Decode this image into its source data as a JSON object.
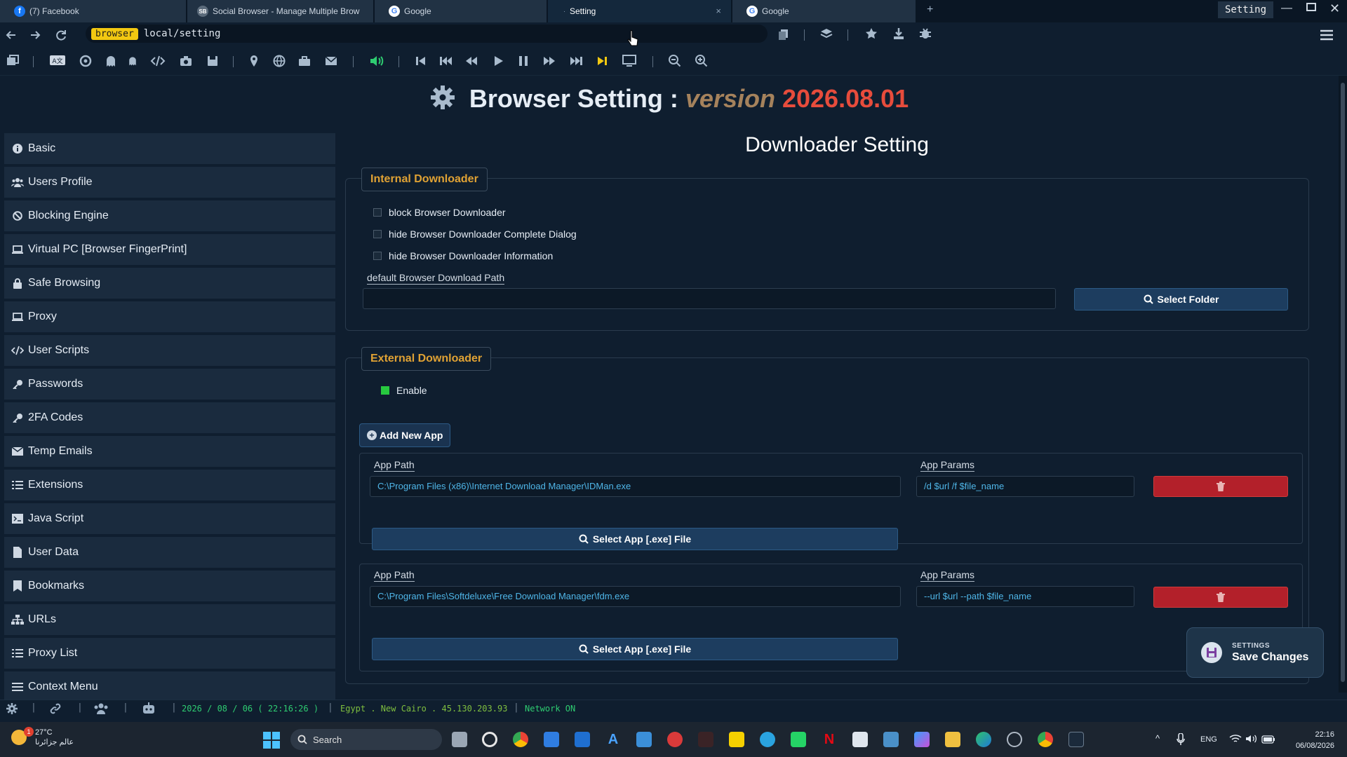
{
  "tabs": [
    {
      "label": "(7) Facebook",
      "favicon": "facebook-icon",
      "color": "#1877f2"
    },
    {
      "label": "Social Browser - Manage Multiple Brow",
      "favicon": "social-browser-icon",
      "color": "#5b6b7b"
    },
    {
      "label": "Google",
      "favicon": "google-icon",
      "color": "#ffffff"
    },
    {
      "label": "Setting",
      "favicon": "setting-icon",
      "active": true,
      "close": "×"
    },
    {
      "label": "Google",
      "favicon": "google-icon",
      "color": "#ffffff"
    }
  ],
  "new_tab": "+",
  "window_title": "Setting",
  "address": {
    "badge": "browser",
    "url": "local/setting"
  },
  "page": {
    "title": "Browser Setting",
    "title_sep": ":",
    "version_label": "version",
    "version_number": "2026.08.01",
    "section_title": "Downloader Setting"
  },
  "sidebar": {
    "items": [
      {
        "label": "Basic",
        "icon": "info-icon"
      },
      {
        "label": "Users Profile",
        "icon": "users-icon"
      },
      {
        "label": "Blocking Engine",
        "icon": "block-icon"
      },
      {
        "label": "Virtual PC [Browser FingerPrint]",
        "icon": "laptop-icon"
      },
      {
        "label": "Safe Browsing",
        "icon": "lock-icon"
      },
      {
        "label": "Proxy",
        "icon": "laptop-icon"
      },
      {
        "label": "User Scripts",
        "icon": "code-icon"
      },
      {
        "label": "Passwords",
        "icon": "key-icon"
      },
      {
        "label": "2FA Codes",
        "icon": "key-icon"
      },
      {
        "label": "Temp Emails",
        "icon": "envelope-icon"
      },
      {
        "label": "Extensions",
        "icon": "list-icon"
      },
      {
        "label": "Java Script",
        "icon": "terminal-icon"
      },
      {
        "label": "User Data",
        "icon": "file-icon"
      },
      {
        "label": "Bookmarks",
        "icon": "bookmark-icon"
      },
      {
        "label": "URLs",
        "icon": "sitemap-icon"
      },
      {
        "label": "Proxy List",
        "icon": "list-icon"
      },
      {
        "label": "Context Menu",
        "icon": "bars-icon"
      }
    ]
  },
  "internal": {
    "legend": "Internal Downloader",
    "checkboxes": [
      {
        "label": "block Browser Downloader",
        "checked": false
      },
      {
        "label": "hide Browser Downloader Complete Dialog",
        "checked": false
      },
      {
        "label": "hide Browser Downloader Information",
        "checked": false
      }
    ],
    "path_label": "default Browser Download Path",
    "path_value": "",
    "select_folder": "Select Folder"
  },
  "external": {
    "legend": "External Downloader",
    "enable_label": "Enable",
    "enabled": true,
    "add_app": "Add New App",
    "apps": [
      {
        "path_label": "App Path",
        "path": "C:\\Program Files (x86)\\Internet Download Manager\\IDMan.exe",
        "params_label": "App Params",
        "params": "/d $url /f $file_name",
        "select_label": "Select App [.exe] File"
      },
      {
        "path_label": "App Path",
        "path": "C:\\Program Files\\Softdeluxe\\Free Download Manager\\fdm.exe",
        "params_label": "App Params",
        "params": "--url $url --path $file_name",
        "select_label": "Select App [.exe] File"
      }
    ]
  },
  "toast": {
    "small": "SETTINGS",
    "big": "Save Changes"
  },
  "status": {
    "datetime": "2026 / 08 / 06 ( 22:16:26 )",
    "location": "Egypt . New Cairo . 45.130.203.93",
    "network": "Network ON",
    "separator": "|"
  },
  "taskbar": {
    "weather_temp": "27°C",
    "weather_desc": "عالم جزائرنا",
    "weather_badge": "1",
    "search": "Search",
    "lang": "ENG",
    "time": "22:16",
    "date": "06/08/2026"
  },
  "colors": {
    "accent_orange": "#e0a234",
    "version_red": "#e74c3c",
    "version_label": "#a5825c",
    "delete_red": "#b3202a",
    "status_green": "#2ecc71",
    "enable_green": "#27c93f"
  }
}
